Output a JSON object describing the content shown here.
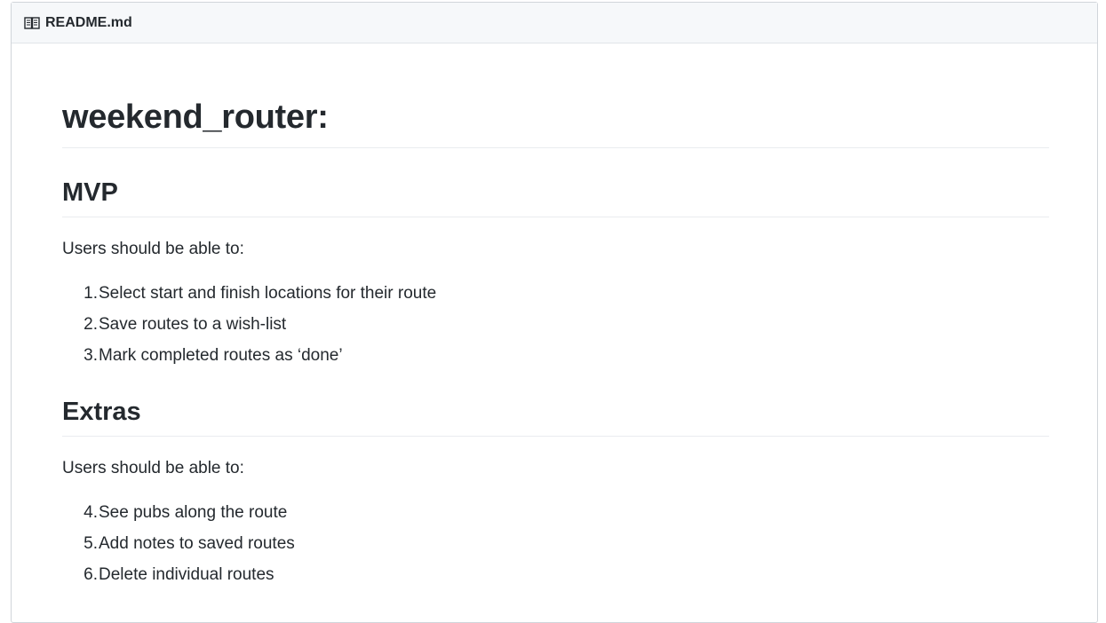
{
  "header": {
    "icon": "book-icon",
    "filename": "README.md"
  },
  "content": {
    "title": "weekend_router:",
    "sections": [
      {
        "heading": "MVP",
        "intro": "Users should be able to:",
        "items": [
          {
            "num": "1.",
            "text": "Select start and finish locations for their route"
          },
          {
            "num": "2.",
            "text": "Save routes to a wish-list"
          },
          {
            "num": "3.",
            "text": "Mark completed routes as ‘done’"
          }
        ]
      },
      {
        "heading": "Extras",
        "intro": "Users should be able to:",
        "items": [
          {
            "num": "4.",
            "text": "See pubs along the route"
          },
          {
            "num": "5.",
            "text": "Add notes to saved routes"
          },
          {
            "num": "6.",
            "text": "Delete individual routes"
          }
        ]
      }
    ]
  }
}
